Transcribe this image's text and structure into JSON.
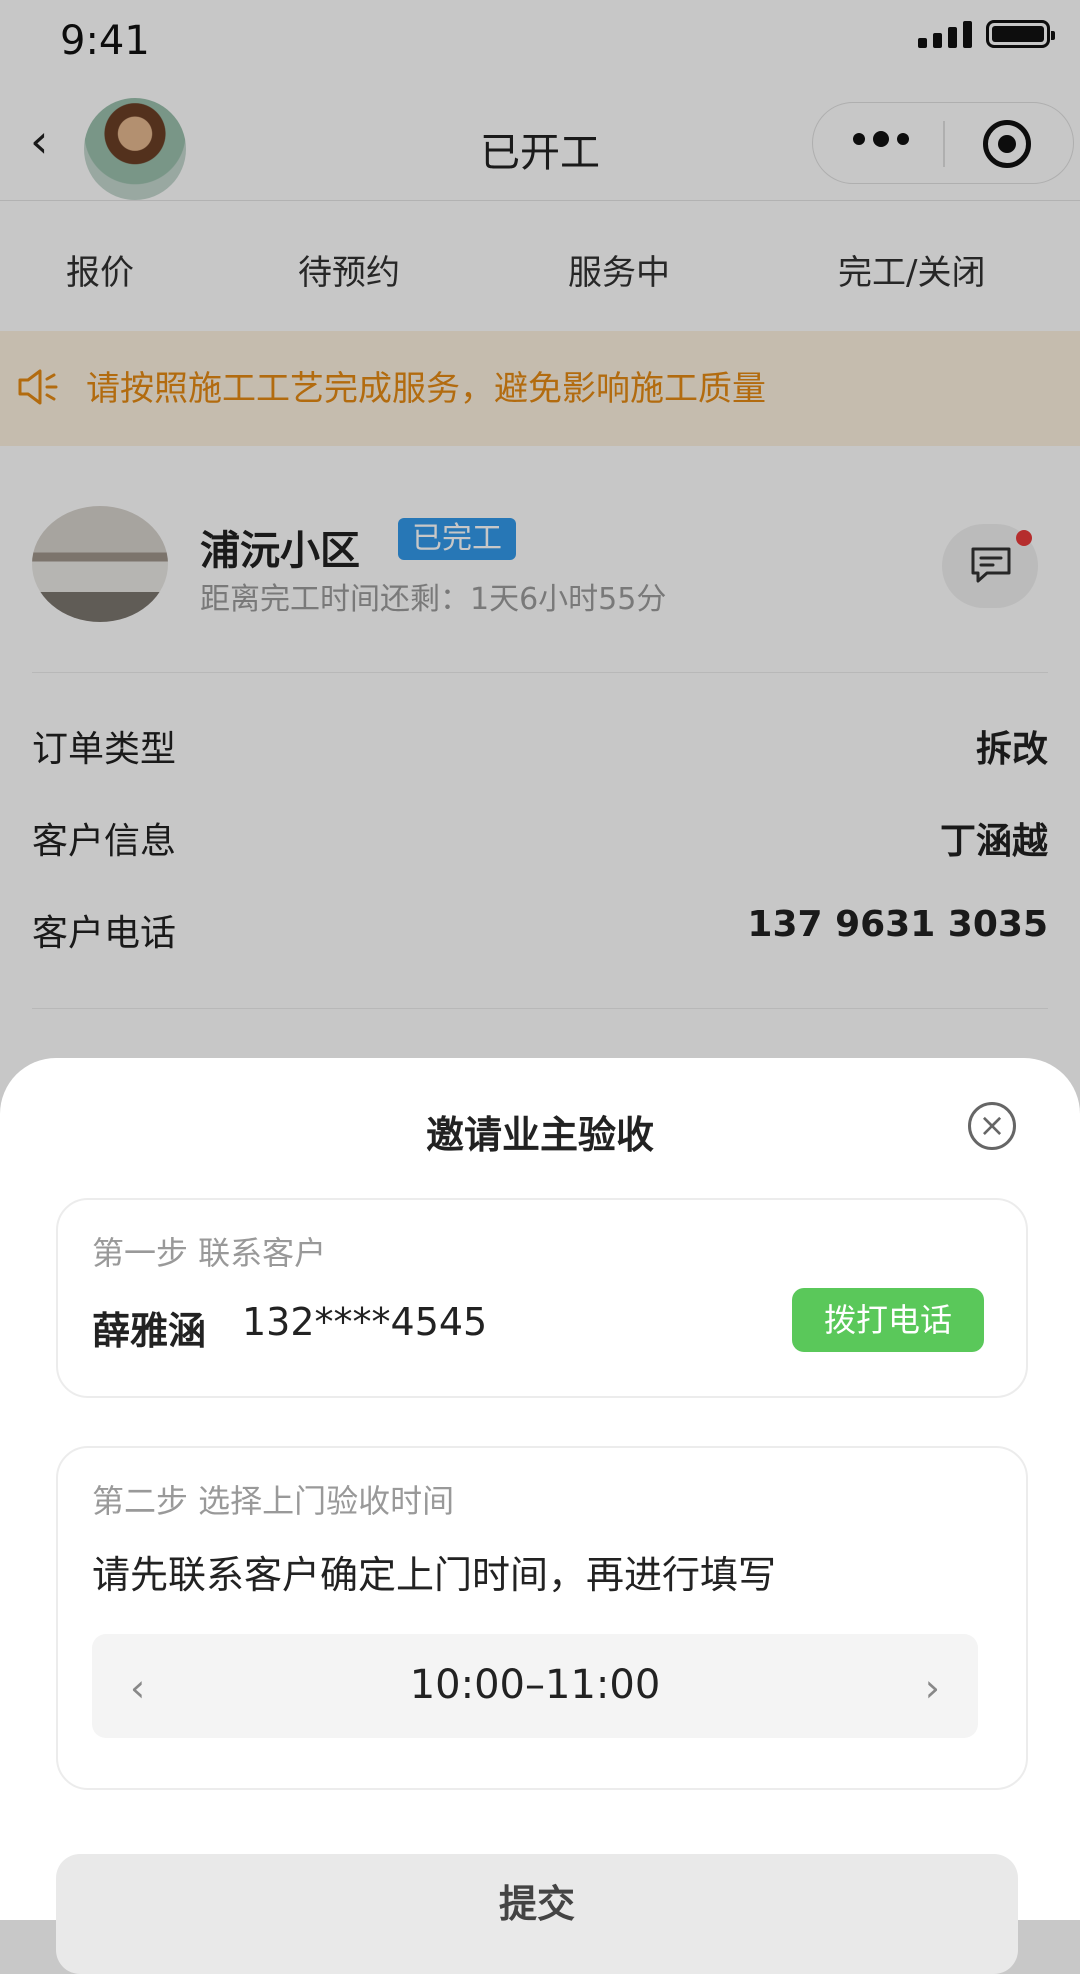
{
  "status_bar": {
    "time": "9:41"
  },
  "nav": {
    "title": "已开工"
  },
  "tabs": [
    {
      "label": "报价"
    },
    {
      "label": "待预约"
    },
    {
      "label": "服务中"
    },
    {
      "label": "完工/关闭"
    }
  ],
  "notice": {
    "text": "请按照施工工艺完成服务，避免影响施工质量",
    "color": "#e58a14"
  },
  "order": {
    "name": "浦沅小区",
    "badge": "已完工",
    "countdown": "距离完工时间还剩：1天6小时55分",
    "rows": [
      {
        "label": "订单类型",
        "value": "拆改"
      },
      {
        "label": "客户信息",
        "value": "丁涵越"
      },
      {
        "label": "客户电话",
        "value": "137 9631 3035"
      }
    ]
  },
  "sheet": {
    "title": "邀请业主验收",
    "step1": {
      "title": "第一步   联系客户",
      "name": "薛雅涵",
      "phone": "132****4545",
      "call_label": "拨打电话"
    },
    "step2": {
      "title": "第二步   选择上门验收时间",
      "instruction": "请先联系客户确定上门时间，再进行填写",
      "time_value": "10:00–11:00"
    },
    "submit_label": "提交"
  },
  "colors": {
    "badge_blue": "#3399ea",
    "call_green": "#5ac85a",
    "notice_bg": "#fdf1df",
    "chat_dot": "#e83a3a"
  }
}
